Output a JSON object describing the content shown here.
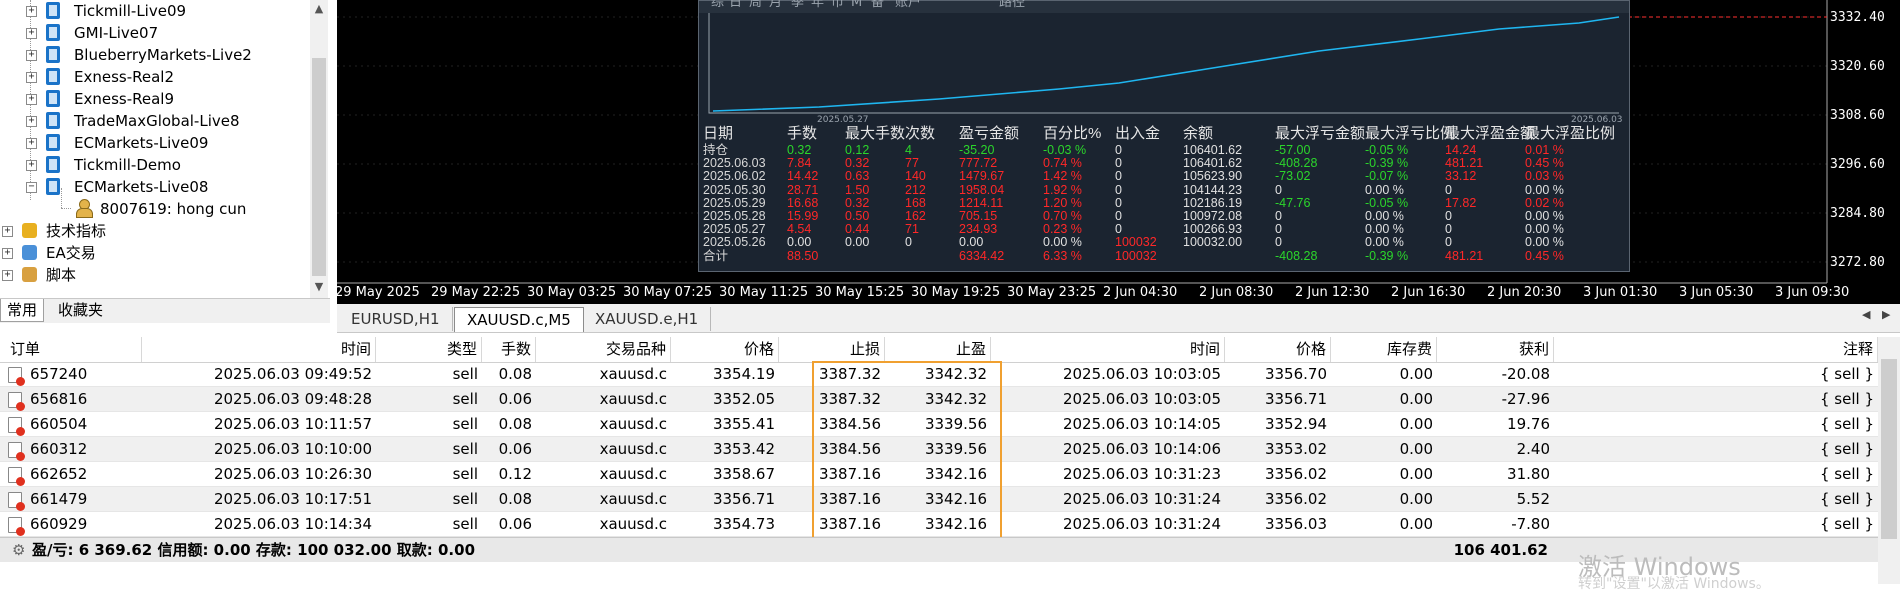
{
  "navigator": {
    "accounts": [
      "Tickmill-Live09",
      "GMI-Live07",
      "BlueberryMarkets-Live2",
      "Exness-Real2",
      "Exness-Real9",
      "TradeMaxGlobal-Live8",
      "ECMarkets-Live09",
      "Tickmill-Demo",
      "ECMarkets-Live08"
    ],
    "account_login": "8007619: hong cun",
    "sections": [
      "技术指标",
      "EA交易",
      "脚本"
    ],
    "tabs": [
      "常用",
      "收藏夹"
    ]
  },
  "chart": {
    "price_ticks": [
      "3332.40",
      "3320.60",
      "3308.60",
      "3296.60",
      "3284.80",
      "3272.80"
    ],
    "time_ticks": [
      "29 May 2025",
      "29 May 22:25",
      "30 May 03:25",
      "30 May 07:25",
      "30 May 11:25",
      "30 May 15:25",
      "30 May 19:25",
      "30 May 23:25",
      "2 Jun 04:30",
      "2 Jun 08:30",
      "2 Jun 12:30",
      "2 Jun 16:30",
      "2 Jun 20:30",
      "3 Jun 01:30",
      "3 Jun 05:30",
      "3 Jun 09:30"
    ],
    "line_color": "#1fb6f0",
    "bid_line_color": "#ff3030"
  },
  "report": {
    "top_tabs": [
      "综",
      "日",
      "周",
      "月",
      "季",
      "年",
      "币",
      "M",
      "备",
      "账户",
      "路径"
    ],
    "mini_dates": [
      "2025.05.27",
      "2025.06.03"
    ],
    "headers": [
      "日期",
      "手数",
      "最大手数",
      "次数",
      "盈亏金额",
      "百分比%",
      "出入金",
      "余额",
      "最大浮亏金额",
      "最大浮亏比例",
      "最大浮盈金额",
      "最大浮盈比例"
    ],
    "rows": [
      [
        "持仓",
        "0.32",
        "0.12",
        "4",
        "-35.20",
        "-0.03 %",
        "0",
        "106401.62",
        "-57.00",
        "-0.05 %",
        "14.24",
        "0.01 %"
      ],
      [
        "2025.06.03",
        "7.84",
        "0.32",
        "77",
        "777.72",
        "0.74 %",
        "0",
        "106401.62",
        "-408.28",
        "-0.39 %",
        "481.21",
        "0.45 %"
      ],
      [
        "2025.06.02",
        "14.42",
        "0.63",
        "140",
        "1479.67",
        "1.42 %",
        "0",
        "105623.90",
        "-73.02",
        "-0.07 %",
        "33.12",
        "0.03 %"
      ],
      [
        "2025.05.30",
        "28.71",
        "1.50",
        "212",
        "1958.04",
        "1.92 %",
        "0",
        "104144.23",
        "0",
        "0.00 %",
        "0",
        "0.00 %"
      ],
      [
        "2025.05.29",
        "16.68",
        "0.32",
        "168",
        "1214.11",
        "1.20 %",
        "0",
        "102186.19",
        "-47.76",
        "-0.05 %",
        "17.82",
        "0.02 %"
      ],
      [
        "2025.05.28",
        "15.99",
        "0.50",
        "162",
        "705.15",
        "0.70 %",
        "0",
        "100972.08",
        "0",
        "0.00 %",
        "0",
        "0.00 %"
      ],
      [
        "2025.05.27",
        "4.54",
        "0.44",
        "71",
        "234.93",
        "0.23 %",
        "0",
        "100266.93",
        "0",
        "0.00 %",
        "0",
        "0.00 %"
      ],
      [
        "2025.05.26",
        "0.00",
        "0.00",
        "0",
        "0.00",
        "0.00 %",
        "100032",
        "100032.00",
        "0",
        "0.00 %",
        "0",
        "0.00 %"
      ],
      [
        "合计",
        "88.50",
        "",
        "",
        "6334.42",
        "6.33 %",
        "100032",
        "",
        "-408.28",
        "-0.39 %",
        "481.21",
        "0.45 %"
      ]
    ]
  },
  "chart_tabs": [
    "EURUSD,H1",
    "XAUUSD.c,M5",
    "XAUUSD.e,H1"
  ],
  "trade": {
    "headers": [
      "订单",
      "时间",
      "类型",
      "手数",
      "交易品种",
      "价格",
      "止损",
      "止盈",
      "时间",
      "价格",
      "库存费",
      "获利",
      "注释"
    ],
    "rows": [
      [
        "657240",
        "2025.06.03 09:49:52",
        "sell",
        "0.08",
        "xauusd.c",
        "3354.19",
        "3387.32",
        "3342.32",
        "2025.06.03 10:03:05",
        "3356.70",
        "0.00",
        "-20.08",
        "{ sell }"
      ],
      [
        "656816",
        "2025.06.03 09:48:28",
        "sell",
        "0.06",
        "xauusd.c",
        "3352.05",
        "3387.32",
        "3342.32",
        "2025.06.03 10:03:05",
        "3356.71",
        "0.00",
        "-27.96",
        "{ sell }"
      ],
      [
        "660504",
        "2025.06.03 10:11:57",
        "sell",
        "0.08",
        "xauusd.c",
        "3355.41",
        "3384.56",
        "3339.56",
        "2025.06.03 10:14:05",
        "3352.94",
        "0.00",
        "19.76",
        "{ sell }"
      ],
      [
        "660312",
        "2025.06.03 10:10:00",
        "sell",
        "0.06",
        "xauusd.c",
        "3353.42",
        "3384.56",
        "3339.56",
        "2025.06.03 10:14:06",
        "3353.02",
        "0.00",
        "2.40",
        "{ sell }"
      ],
      [
        "662652",
        "2025.06.03 10:26:30",
        "sell",
        "0.12",
        "xauusd.c",
        "3358.67",
        "3387.16",
        "3342.16",
        "2025.06.03 10:31:23",
        "3356.02",
        "0.00",
        "31.80",
        "{ sell }"
      ],
      [
        "661479",
        "2025.06.03 10:17:51",
        "sell",
        "0.08",
        "xauusd.c",
        "3356.71",
        "3387.16",
        "3342.16",
        "2025.06.03 10:31:24",
        "3356.02",
        "0.00",
        "5.52",
        "{ sell }"
      ],
      [
        "660929",
        "2025.06.03 10:14:34",
        "sell",
        "0.06",
        "xauusd.c",
        "3354.73",
        "3387.16",
        "3342.16",
        "2025.06.03 10:31:24",
        "3356.03",
        "0.00",
        "-7.80",
        "{ sell }"
      ]
    ],
    "summary_text": "盈/亏: 6 369.62  信用额: 0.00  存款: 100 032.00  取款: 0.00",
    "summary_total": "106 401.62",
    "highlight_color": "#f0a030"
  },
  "watermark": {
    "line1": "激活 Windows",
    "line2": "转到\"设置\"以激活 Windows。"
  }
}
